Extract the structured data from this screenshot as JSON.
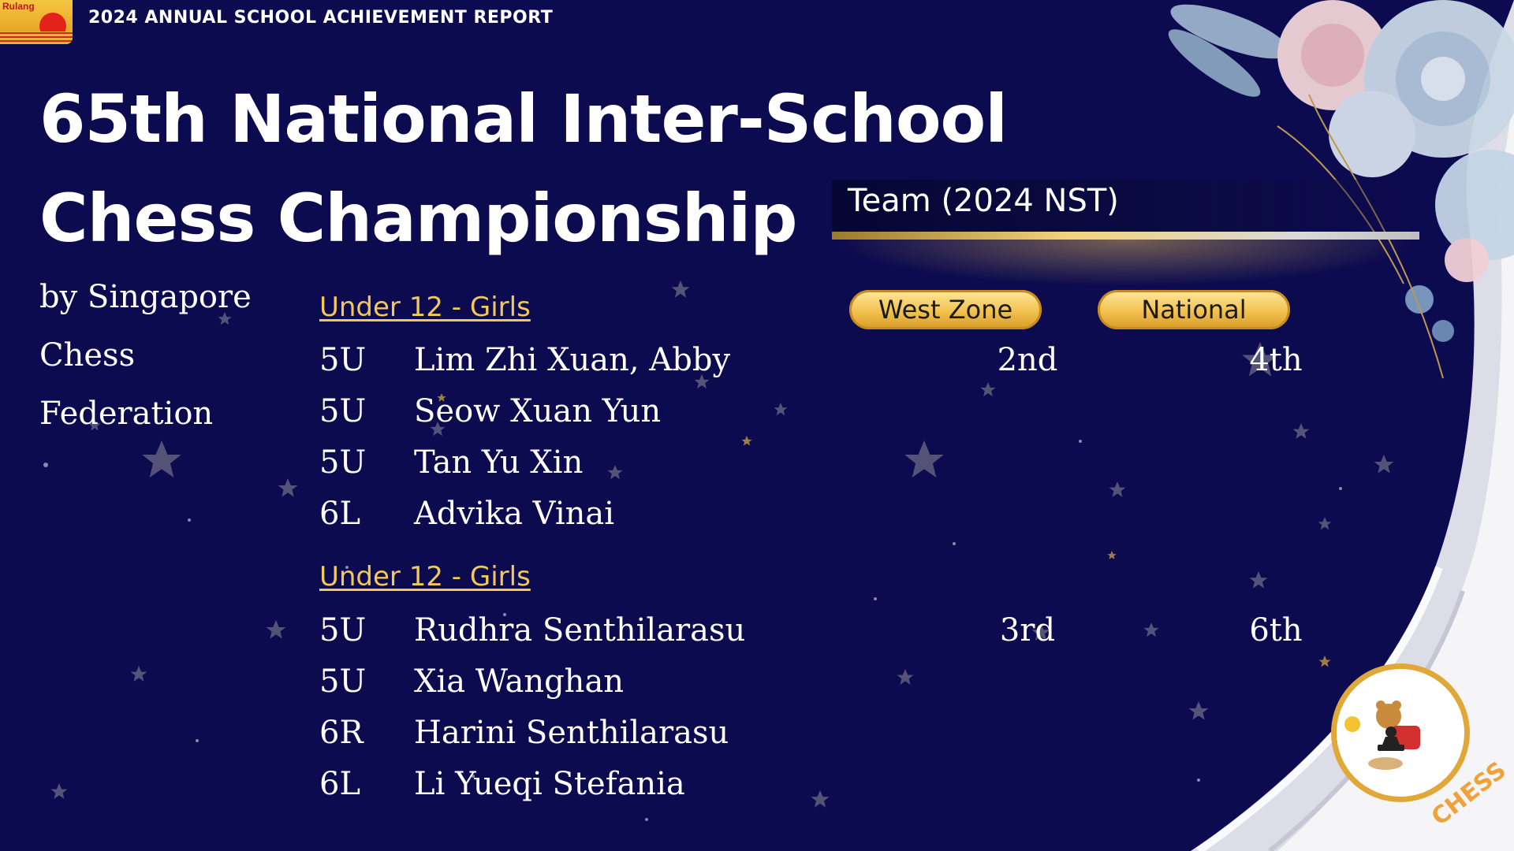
{
  "header": {
    "logo_text": "Rulang",
    "report_title": "2024 ANNUAL SCHOOL ACHIEVEMENT REPORT"
  },
  "title": {
    "line1": "65th National Inter-School",
    "line2": "Chess Championship"
  },
  "subtitle": {
    "line1": "by Singapore",
    "line2": "Chess",
    "line3": "Federation"
  },
  "team_label": "Team (2024 NST)",
  "columns": {
    "west_zone": "West Zone",
    "national": "National"
  },
  "sections": [
    {
      "heading": "Under 12 - Girls",
      "rows": [
        {
          "class": "5U",
          "name": "Lim Zhi Xuan, Abby",
          "west": "2nd",
          "national": "4th"
        },
        {
          "class": "5U",
          "name": "Seow Xuan Yun",
          "west": "",
          "national": ""
        },
        {
          "class": "5U",
          "name": "Tan Yu Xin",
          "west": "",
          "national": ""
        },
        {
          "class": "6L",
          "name": "Advika Vinai",
          "west": "",
          "national": ""
        }
      ]
    },
    {
      "heading": "Under 12 - Girls",
      "rows": [
        {
          "class": "5U",
          "name": "Rudhra Senthilarasu",
          "west": "3rd",
          "national": "6th"
        },
        {
          "class": "5U",
          "name": "Xia Wanghan",
          "west": "",
          "national": ""
        },
        {
          "class": "6R",
          "name": "Harini Senthilarasu",
          "west": "",
          "national": ""
        },
        {
          "class": "6L",
          "name": "Li Yueqi Stefania",
          "west": "",
          "national": ""
        }
      ]
    }
  ],
  "badge": {
    "text": "CHESS",
    "icon": "chess-bear-icon"
  },
  "colors": {
    "background": "#0c0b4f",
    "gold": "#f3c75a",
    "text": "#ffffff"
  }
}
